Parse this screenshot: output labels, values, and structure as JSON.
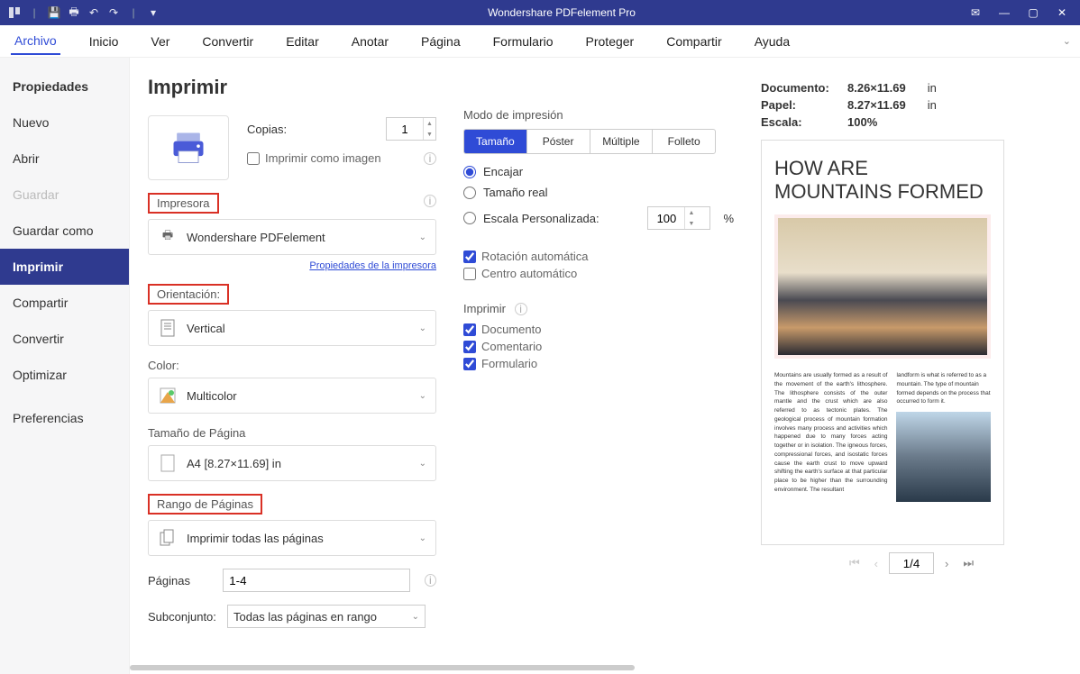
{
  "app_title": "Wondershare PDFelement Pro",
  "menubar": [
    "Archivo",
    "Inicio",
    "Ver",
    "Convertir",
    "Editar",
    "Anotar",
    "Página",
    "Formulario",
    "Proteger",
    "Compartir",
    "Ayuda"
  ],
  "sidebar": {
    "items": [
      {
        "label": "Propiedades",
        "state": "bold"
      },
      {
        "label": "Nuevo"
      },
      {
        "label": "Abrir"
      },
      {
        "label": "Guardar",
        "state": "disabled"
      },
      {
        "label": "Guardar como"
      },
      {
        "label": "Imprimir",
        "state": "active"
      },
      {
        "label": "Compartir"
      },
      {
        "label": "Convertir"
      },
      {
        "label": "Optimizar"
      },
      {
        "label": "Preferencias"
      }
    ]
  },
  "page_title": "Imprimir",
  "copies": {
    "label": "Copias:",
    "value": "1"
  },
  "print_as_image": {
    "label": "Imprimir como imagen"
  },
  "printer": {
    "section": "Impresora",
    "value": "Wondershare PDFelement",
    "props_link": "Propiedades de la impresora"
  },
  "orientation": {
    "section": "Orientación:",
    "value": "Vertical"
  },
  "color": {
    "section": "Color:",
    "value": "Multicolor"
  },
  "pagesize": {
    "section": "Tamaño de Página",
    "value": "A4 [8.27×11.69] in"
  },
  "pagerange": {
    "section": "Rango de Páginas",
    "value": "Imprimir todas las páginas"
  },
  "pages_row": {
    "label": "Páginas",
    "value": "1-4"
  },
  "subset_row": {
    "label": "Subconjunto:",
    "value": "Todas las páginas en rango"
  },
  "print_mode": {
    "label": "Modo de impresión",
    "tabs": [
      "Tamaño",
      "Póster",
      "Múltiple",
      "Folleto"
    ],
    "radios": [
      "Encajar",
      "Tamaño real",
      "Escala Personalizada:"
    ],
    "scale_value": "100",
    "scale_unit": "%",
    "auto_rotate": "Rotación automática",
    "auto_center": "Centro automático"
  },
  "print_section": {
    "label": "Imprimir",
    "items": [
      "Documento",
      "Comentario",
      "Formulario"
    ]
  },
  "docinfo": {
    "doc_k": "Documento:",
    "doc_v": "8.26×11.69",
    "doc_u": "in",
    "paper_k": "Papel:",
    "paper_v": "8.27×11.69",
    "paper_u": "in",
    "scale_k": "Escala:",
    "scale_v": "100%"
  },
  "preview": {
    "title": "HOW ARE MOUNTAINS FORMED",
    "col1": "Mountains are usually formed as a result of the movement of the earth's lithosphere. The lithosphere consists of the outer mantle and the crust which are also referred to as tectonic plates. The geological process of mountain formation involves many process and activities which happened due to many forces acting together or in isolation. The igneous forces, compressional forces, and isostatic forces cause the earth crust to move upward shifting the earth's surface at that particular place to be higher than the surrounding environment. The resultant",
    "col2": "landform is what is referred to as a mountain. The type of mountain formed depends on the process that occurred to form it."
  },
  "pager": {
    "value": "1/4"
  }
}
